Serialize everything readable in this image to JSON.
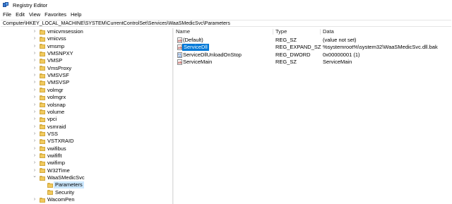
{
  "window": {
    "title": "Registry Editor",
    "icon": "registry-icon"
  },
  "menu": [
    "File",
    "Edit",
    "View",
    "Favorites",
    "Help"
  ],
  "address": "Computer\\HKEY_LOCAL_MACHINE\\SYSTEM\\CurrentControlSet\\Services\\WaaSMedicSvc\\Parameters",
  "tree": [
    {
      "label": "vmicvmsession",
      "level": 0,
      "expandable": true
    },
    {
      "label": "vmicvss",
      "level": 0,
      "expandable": true
    },
    {
      "label": "vmsmp",
      "level": 0,
      "expandable": true
    },
    {
      "label": "VMSNPXY",
      "level": 0,
      "expandable": true
    },
    {
      "label": "VMSP",
      "level": 0,
      "expandable": true
    },
    {
      "label": "VmsProxy",
      "level": 0,
      "expandable": true
    },
    {
      "label": "VMSVSF",
      "level": 0,
      "expandable": true
    },
    {
      "label": "VMSVSP",
      "level": 0,
      "expandable": true
    },
    {
      "label": "volmgr",
      "level": 0,
      "expandable": true
    },
    {
      "label": "volmgrx",
      "level": 0,
      "expandable": true
    },
    {
      "label": "volsnap",
      "level": 0,
      "expandable": true
    },
    {
      "label": "volume",
      "level": 0,
      "expandable": true
    },
    {
      "label": "vpci",
      "level": 0,
      "expandable": true
    },
    {
      "label": "vsmraid",
      "level": 0,
      "expandable": true
    },
    {
      "label": "VSS",
      "level": 0,
      "expandable": true
    },
    {
      "label": "VSTXRAID",
      "level": 0,
      "expandable": true
    },
    {
      "label": "vwifibus",
      "level": 0,
      "expandable": true
    },
    {
      "label": "vwififlt",
      "level": 0,
      "expandable": true
    },
    {
      "label": "vwifimp",
      "level": 0,
      "expandable": true
    },
    {
      "label": "W32Time",
      "level": 0,
      "expandable": true
    },
    {
      "label": "WaaSMedicSvc",
      "level": 0,
      "expanded": true
    },
    {
      "label": "Parameters",
      "level": 1,
      "selected": true
    },
    {
      "label": "Security",
      "level": 1
    },
    {
      "label": "WacomPen",
      "level": 0,
      "expandable": true
    }
  ],
  "columns": {
    "name": "Name",
    "type": "Type",
    "data": "Data"
  },
  "values": [
    {
      "icon": "string-value-icon",
      "name": "(Default)",
      "type": "REG_SZ",
      "data": "(value not set)"
    },
    {
      "icon": "string-value-icon",
      "name": "ServiceDll",
      "type": "REG_EXPAND_SZ",
      "data": "%systemroot%\\system32\\WaaSMedicSvc.dll.bak",
      "selected": true
    },
    {
      "icon": "binary-value-icon",
      "name": "ServiceDllUnloadOnStop",
      "type": "REG_DWORD",
      "data": "0x00000001 (1)"
    },
    {
      "icon": "string-value-icon",
      "name": "ServiceMain",
      "type": "REG_SZ",
      "data": "ServiceMain"
    }
  ],
  "colors": {
    "selection": "#0078d7",
    "tree_selection": "#cce8ff",
    "folder": "#f1ca5e"
  }
}
